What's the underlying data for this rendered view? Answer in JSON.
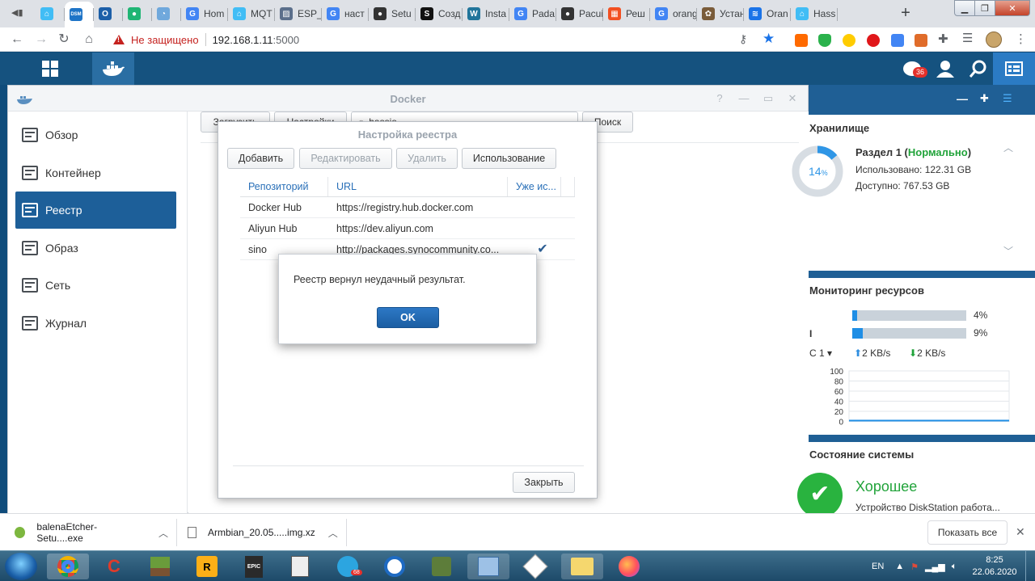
{
  "browser": {
    "tabs": [
      {
        "label": "",
        "icon": "ha-icon",
        "color": "#41bdf5"
      },
      {
        "label": "",
        "icon": "dsm-icon",
        "color": "#1e74c7",
        "active": true
      },
      {
        "label": "",
        "icon": "o-icon",
        "color": "#1c5fa8"
      },
      {
        "label": "",
        "icon": "green-blob-icon",
        "color": "#1fb574"
      },
      {
        "label": "",
        "icon": "speed-icon",
        "color": "#6fa8dc"
      },
      {
        "label": "Hom",
        "icon": "google-icon",
        "color": "#4285f4"
      },
      {
        "label": "MQT",
        "icon": "ha-icon",
        "color": "#41bdf5"
      },
      {
        "label": "ESP_",
        "icon": "stripes-icon",
        "color": "#5b6f8b"
      },
      {
        "label": "наст",
        "icon": "google-icon",
        "color": "#4285f4"
      },
      {
        "label": "Setu",
        "icon": "gh-icon",
        "color": "#333333"
      },
      {
        "label": "Созд",
        "icon": "s-icon",
        "color": "#111111"
      },
      {
        "label": "Insta",
        "icon": "wp-icon",
        "color": "#21759b"
      },
      {
        "label": "Pada",
        "icon": "google-icon",
        "color": "#4285f4"
      },
      {
        "label": "Pacui",
        "icon": "gh-icon",
        "color": "#333333"
      },
      {
        "label": "Реш",
        "icon": "ms-icon",
        "color": "#f25022"
      },
      {
        "label": "orang",
        "icon": "google-icon",
        "color": "#4285f4"
      },
      {
        "label": "Устан",
        "icon": "gear-icon",
        "color": "#7a5c3a"
      },
      {
        "label": "Oran",
        "icon": "wifi-icon",
        "color": "#1a73e8"
      },
      {
        "label": "Hass",
        "icon": "ha-icon",
        "color": "#41bdf5"
      }
    ],
    "new_tab": "+",
    "insecure_label": "Не защищено",
    "url_host": "192.168.1.11",
    "url_port": ":5000"
  },
  "docker": {
    "window_title": "Docker",
    "sidebar": [
      {
        "label": "Обзор",
        "icon": "overview-icon"
      },
      {
        "label": "Контейнер",
        "icon": "container-icon"
      },
      {
        "label": "Реестр",
        "icon": "registry-icon",
        "active": true
      },
      {
        "label": "Образ",
        "icon": "image-icon"
      },
      {
        "label": "Сеть",
        "icon": "network-icon"
      },
      {
        "label": "Журнал",
        "icon": "log-icon"
      }
    ],
    "toolbar": {
      "download": "Загрузить",
      "settings": "Настройки",
      "search_value": "hassio",
      "search_button": "Поиск"
    }
  },
  "registry_dialog": {
    "title": "Настройка реестра",
    "buttons": {
      "add": "Добавить",
      "edit": "Редактировать",
      "delete": "Удалить",
      "use": "Использование"
    },
    "columns": [
      "Репозиторий",
      "URL",
      "Уже ис..."
    ],
    "rows": [
      {
        "repo": "Docker Hub",
        "url": "https://registry.hub.docker.com",
        "in_use": false
      },
      {
        "repo": "Aliyun Hub",
        "url": "https://dev.aliyun.com",
        "in_use": false
      },
      {
        "repo": "sino",
        "url": "http://packages.synocommunity.co...",
        "in_use": true
      }
    ],
    "close": "Закрыть"
  },
  "alert": {
    "message": "Реестр вернул неудачный результат.",
    "ok": "OK"
  },
  "widgets": {
    "storage": {
      "title": "Хранилище",
      "percent": "14",
      "percent_unit": "%",
      "volume": "Раздел 1",
      "status": "Нормально",
      "used": "Использовано: 122.31 GB",
      "free": "Доступно: 767.53 GB"
    },
    "monitor": {
      "title": "Мониторинг ресурсов",
      "cpu_pct": "4%",
      "cpu_value": 0.04,
      "ram_label": "I",
      "ram_pct": "9%",
      "ram_value": 0.09,
      "lan": "С 1",
      "up": "2 KB/s",
      "down": "2 KB/s",
      "chart_ticks": [
        "100",
        "80",
        "60",
        "40",
        "20",
        "0"
      ]
    },
    "health": {
      "title": "Состояние системы",
      "status": "Хорошее",
      "desc": "Устройство DiskStation работа..."
    },
    "notifications_count": "36"
  },
  "downloads": {
    "items": [
      {
        "name": "balenaEtcher-Setu....exe"
      },
      {
        "name": "Armbian_20.05.....img.xz"
      }
    ],
    "show_all": "Показать все"
  },
  "taskbar": {
    "lang": "EN",
    "time": "8:25",
    "date": "22.06.2020",
    "telegram_badge": "68"
  }
}
